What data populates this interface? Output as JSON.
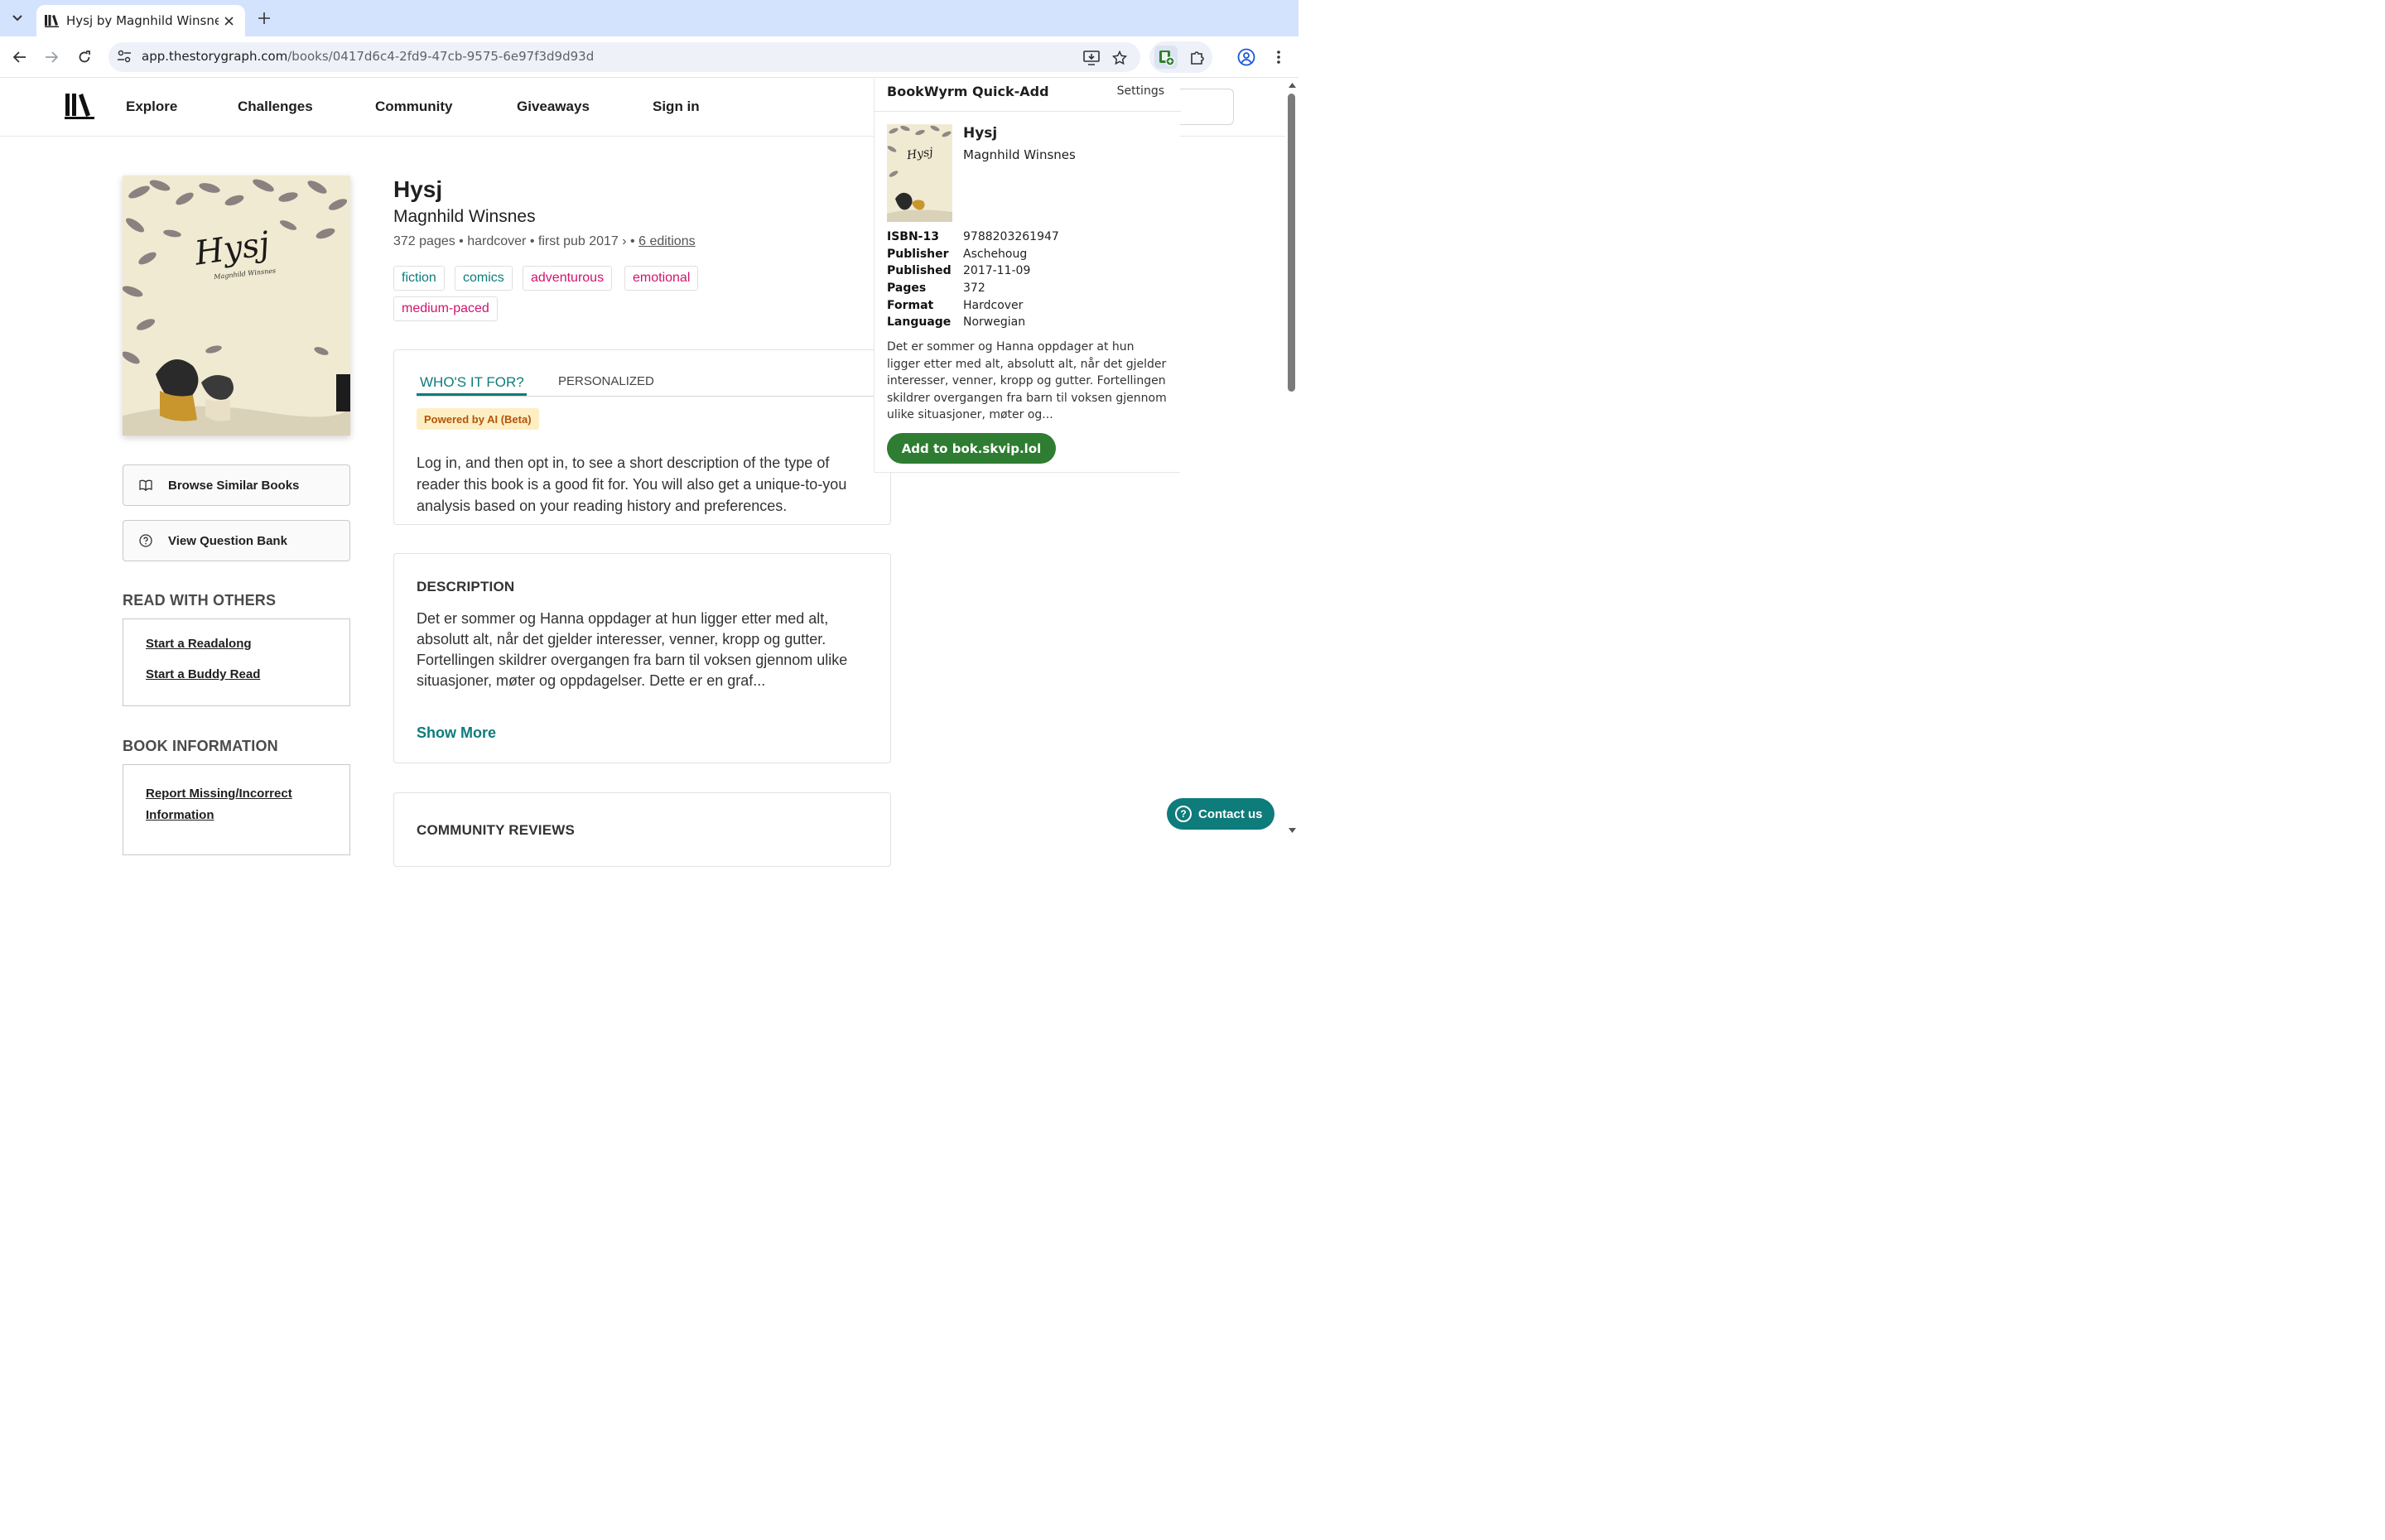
{
  "browser": {
    "tab_title": "Hysj by Magnhild Winsnes",
    "url_host": "app.thestorygraph.com",
    "url_path": "/books/0417d6c4-2fd9-47cb-9575-6e97f3d9d93d"
  },
  "site": {
    "nav": [
      "Explore",
      "Challenges",
      "Community",
      "Giveaways",
      "Sign in"
    ]
  },
  "book": {
    "title": "Hysj",
    "author": "Magnhild Winsnes",
    "meta": "372 pages • hardcover • first pub 2017 ›  •",
    "editions": "6 editions",
    "tags": [
      {
        "label": "fiction",
        "color": "#0e7c7b"
      },
      {
        "label": "comics",
        "color": "#0e7c7b"
      },
      {
        "label": "adventurous",
        "color": "#d1136f"
      },
      {
        "label": "emotional",
        "color": "#d1136f"
      },
      {
        "label": "medium-paced",
        "color": "#d1136f"
      }
    ],
    "cover_title": "Hysj",
    "cover_author": "Magnhild Winsnes"
  },
  "sidebar": {
    "browse_similar": "Browse Similar Books",
    "question_bank": "View Question Bank",
    "read_with_others": "READ WITH OTHERS",
    "start_readalong": "Start a Readalong",
    "start_buddy_read": "Start a Buddy Read",
    "book_information": "BOOK INFORMATION",
    "report_line1": "Report Missing/Incorrect",
    "report_line2": "Information"
  },
  "whos_it_for": {
    "tab_active": "WHO'S IT FOR?",
    "tab_other": "PERSONALIZED",
    "badge": "Powered by AI (Beta)",
    "body": "Log in, and then opt in, to see a short description of the type of reader this book is a good fit for. You will also get a unique-to-you analysis based on your reading history and preferences."
  },
  "description": {
    "heading": "DESCRIPTION",
    "body": "Det er sommer og Hanna oppdager at hun ligger etter med alt, absolutt alt, når det gjelder interesser, venner, kropp og gutter. Fortellingen skildrer overgangen fra barn til voksen gjennom ulike situasjoner, møter og oppdagelser. Dette er en graf...",
    "show_more": "Show More"
  },
  "reviews": {
    "heading": "COMMUNITY REVIEWS"
  },
  "extension": {
    "title": "BookWyrm Quick-Add",
    "settings": "Settings",
    "book_title": "Hysj",
    "book_author": "Magnhild Winsnes",
    "fields": [
      {
        "key": "ISBN-13",
        "value": "9788203261947"
      },
      {
        "key": "Publisher",
        "value": "Aschehoug"
      },
      {
        "key": "Published",
        "value": "2017-11-09"
      },
      {
        "key": "Pages",
        "value": "372"
      },
      {
        "key": "Format",
        "value": "Hardcover"
      },
      {
        "key": "Language",
        "value": "Norwegian"
      }
    ],
    "description": "Det er sommer og Hanna oppdager at hun ligger etter med alt, absolutt alt, når det gjelder interesser, venner, kropp og gutter. Fortellingen skildrer overgangen fra barn til voksen gjennom ulike situasjoner, møter og...",
    "add_button": "Add to bok.skvip.lol",
    "accent": "#2e7d32"
  },
  "contact": {
    "label": "Contact us"
  },
  "colors": {
    "teal": "#0e7c7b",
    "pink": "#d1136f",
    "chrome": "#d3e3fd"
  }
}
